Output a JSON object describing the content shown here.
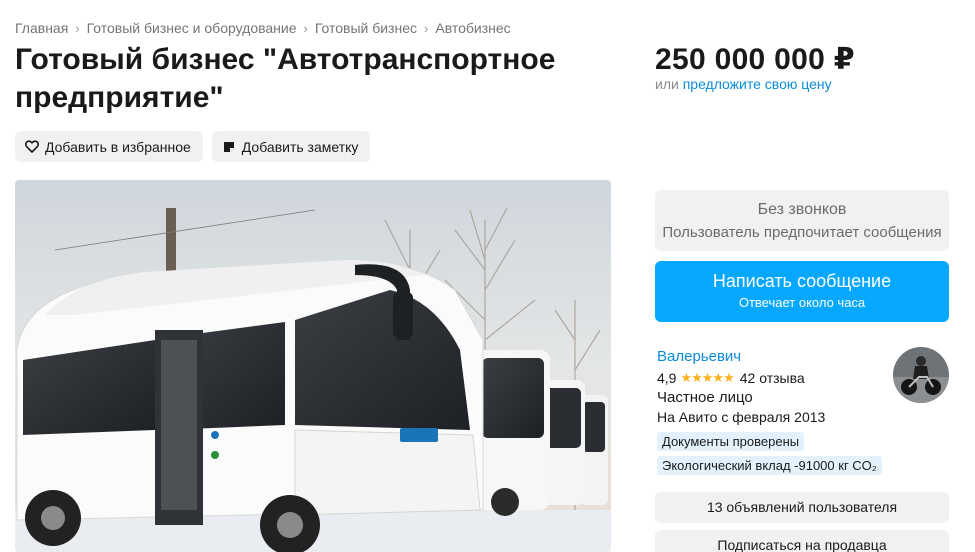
{
  "breadcrumb": {
    "items": [
      "Главная",
      "Готовый бизнес и оборудование",
      "Готовый бизнес",
      "Автобизнес"
    ],
    "separator": "›"
  },
  "listing": {
    "title": "Готовый бизнес \"Автотранспортное предприятие\"",
    "price": "250 000 000 ₽",
    "offer_prefix": "или",
    "offer_link": "предложите свою цену"
  },
  "actions": {
    "favorite_label": "Добавить в избранное",
    "note_label": "Добавить заметку"
  },
  "contact": {
    "no_calls_title": "Без звонков",
    "no_calls_sub": "Пользователь предпочитает сообщения",
    "write_label": "Написать сообщение",
    "write_sub": "Отвечает около часа"
  },
  "seller": {
    "name": "Валерьевич",
    "rating": "4,9",
    "stars": "★★★★★",
    "reviews": "42 отзыва",
    "type": "Частное лицо",
    "since": "На Авито с февраля 2013",
    "badge_docs": "Документы проверены",
    "badge_eco": "Экологический вклад -91000 кг CO₂",
    "ads_label": "13 объявлений пользователя",
    "subscribe_label": "Подписаться на продавца"
  },
  "colors": {
    "accent": "#06a8ff",
    "link": "#0a8bd9",
    "star": "#ffb021",
    "button_gray": "#f2f1f0",
    "badge_bg": "#e3f1fd"
  },
  "icons": {
    "favorite": "heart-icon",
    "note": "note-icon"
  }
}
